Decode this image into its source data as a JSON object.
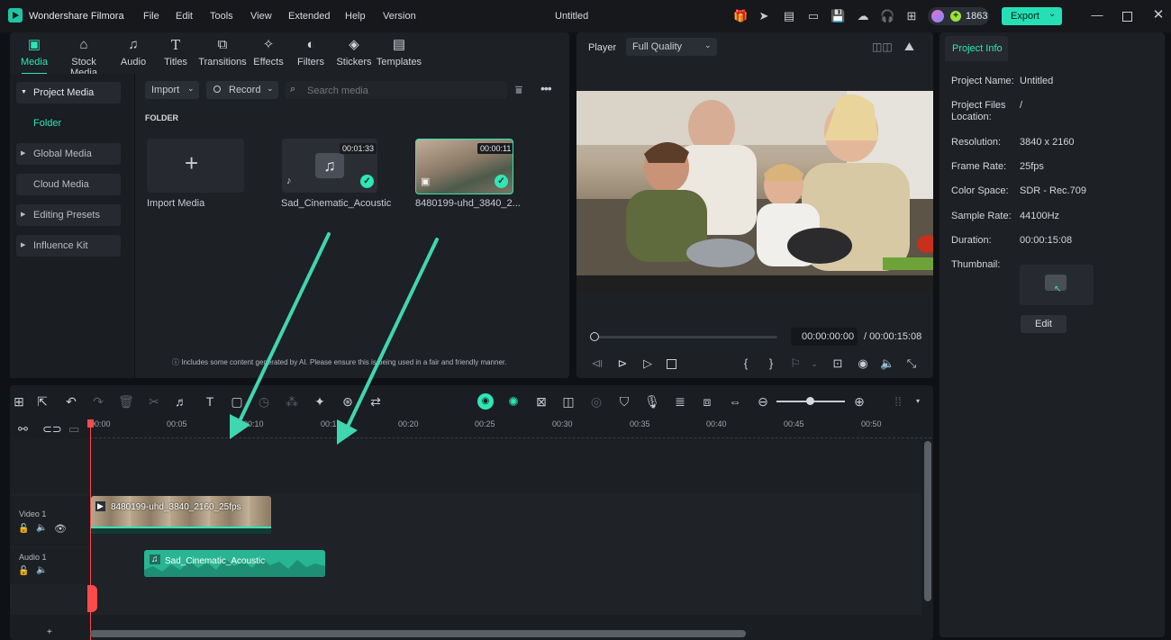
{
  "app": {
    "name": "Wondershare Filmora",
    "title": "Untitled",
    "menu": [
      "File",
      "Edit",
      "Tools",
      "View",
      "Extended",
      "Help",
      "Version"
    ],
    "credits": "1863",
    "export_label": "Export"
  },
  "media_tabs": [
    {
      "label": "Media",
      "icon": "media-icon"
    },
    {
      "label": "Stock Media",
      "icon": "stock-media-icon"
    },
    {
      "label": "Audio",
      "icon": "audio-icon"
    },
    {
      "label": "Titles",
      "icon": "titles-icon"
    },
    {
      "label": "Transitions",
      "icon": "transitions-icon"
    },
    {
      "label": "Effects",
      "icon": "effects-icon"
    },
    {
      "label": "Filters",
      "icon": "filters-icon"
    },
    {
      "label": "Stickers",
      "icon": "stickers-icon"
    },
    {
      "label": "Templates",
      "icon": "templates-icon"
    }
  ],
  "sidebar": {
    "project_media": "Project Media",
    "folder": "Folder",
    "global_media": "Global Media",
    "cloud_media": "Cloud Media",
    "editing_presets": "Editing Presets",
    "influence_kit": "Influence Kit"
  },
  "media_toolbar": {
    "import_label": "Import",
    "record_label": "Record",
    "search_placeholder": "Search media"
  },
  "folder_label": "FOLDER",
  "media_items": {
    "import": {
      "label": "Import Media"
    },
    "audio": {
      "label": "Sad_Cinematic_Acoustic",
      "duration": "00:01:33"
    },
    "video": {
      "label": "8480199-uhd_3840_2...",
      "duration": "00:00:11"
    }
  },
  "ai_notice": "Includes some content generated by AI. Please ensure this is being used in a fair and friendly manner.",
  "player": {
    "label": "Player",
    "quality": "Full Quality",
    "current_time": "00:00:00:00",
    "total_time": "/ 00:00:15:08",
    "progress": 0
  },
  "project_info": {
    "tab": "Project Info",
    "rows": [
      {
        "label": "Project Name:",
        "value": "Untitled"
      },
      {
        "label": "Project Files Location:",
        "value": "/"
      },
      {
        "label": "Resolution:",
        "value": "3840 x 2160"
      },
      {
        "label": "Frame Rate:",
        "value": "25fps"
      },
      {
        "label": "Color Space:",
        "value": "SDR - Rec.709"
      },
      {
        "label": "Sample Rate:",
        "value": "44100Hz"
      },
      {
        "label": "Duration:",
        "value": "00:00:15:08"
      }
    ],
    "thumbnail_label": "Thumbnail:",
    "edit_label": "Edit"
  },
  "timeline": {
    "ruler": [
      "00:00",
      "00:05",
      "00:10",
      "00:15",
      "00:20",
      "00:25",
      "00:30",
      "00:35",
      "00:40",
      "00:45",
      "00:50"
    ],
    "tracks": {
      "video": {
        "name": "Video 1",
        "clip": "8480199-uhd_3840_2160_25fps"
      },
      "audio": {
        "name": "Audio 1",
        "clip": "Sad_Cinematic_Acoustic"
      }
    }
  },
  "colors": {
    "accent": "#2ee6b6",
    "export": "#26e0b5",
    "arrow": "#3fd6b0",
    "playhead": "#ff4a4a"
  }
}
